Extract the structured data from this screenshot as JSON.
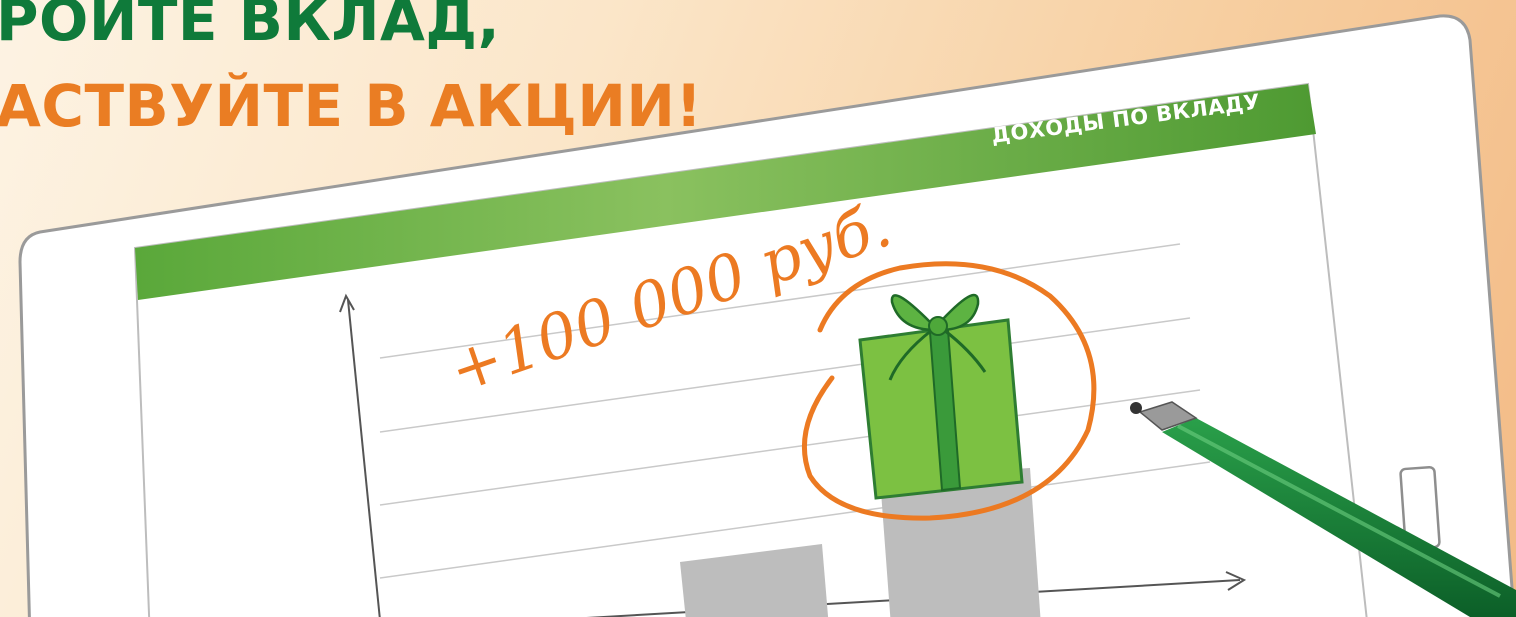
{
  "banner": {
    "headline_line1": "РОЙТЕ ВКЛАД,",
    "headline_line2": "АСТВУЙТЕ В АКЦИИ!",
    "colors": {
      "green": "#0f7a3a",
      "orange": "#ea7d23"
    }
  },
  "tablet": {
    "screen_title": "ДОХОДЫ ПО ВКЛАДУ",
    "handwritten_amount": "+100 000 руб.",
    "icons": [
      "gift-icon",
      "stylus-pen-icon",
      "home-button-icon"
    ]
  }
}
